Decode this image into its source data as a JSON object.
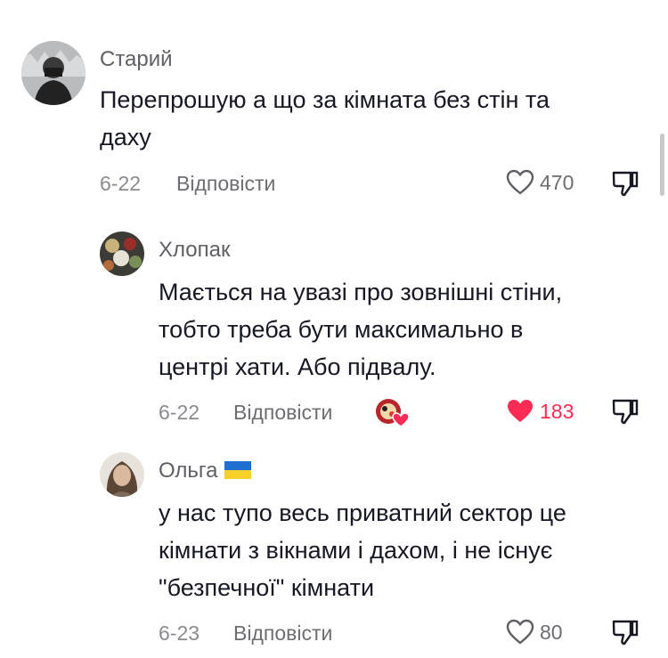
{
  "comments": [
    {
      "author": "Старий",
      "text_lines": [
        "Перепрошую а що за кімната без стін та",
        "даху"
      ],
      "date": "6-22",
      "reply_label": "Відповісти",
      "likes": "470",
      "liked": false
    },
    {
      "author": "Хлопак",
      "text_lines": [
        "Мається на увазі про зовнішні стіни,",
        "тобто треба бути максимально в",
        "центрі хати. Або підвалу."
      ],
      "date": "6-22",
      "reply_label": "Відповісти",
      "likes": "183",
      "liked": true
    },
    {
      "author": "Ольга",
      "author_flag": "ukraine-flag",
      "text_lines": [
        "у нас тупо весь приватний сектор це",
        "кімнати з вікнами і дахом, і не існує",
        "\"безпечної\" кімнати"
      ],
      "date": "6-23",
      "reply_label": "Відповісти",
      "likes": "80",
      "liked": false
    }
  ],
  "colors": {
    "like_active": "#fe2c55",
    "text": "#161823",
    "secondary": "#8a8b91"
  }
}
